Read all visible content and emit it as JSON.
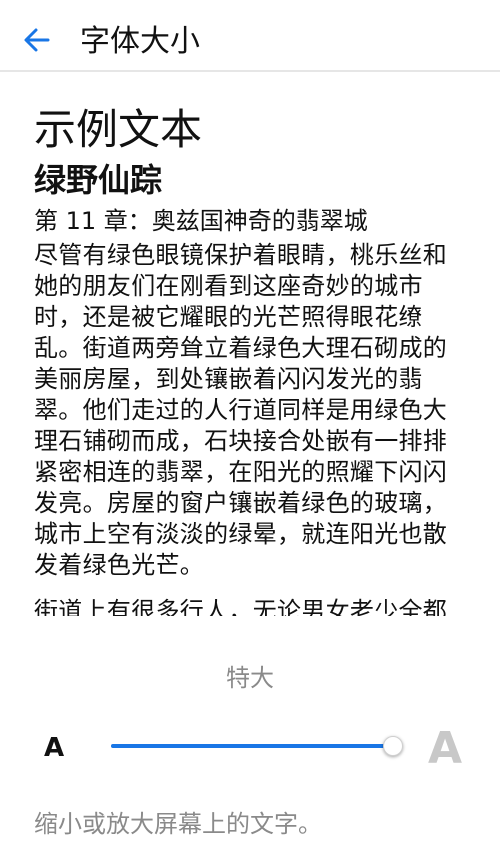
{
  "topbar": {
    "title": "字体大小",
    "back_icon": "arrow-left-icon",
    "accent": "#1976e6"
  },
  "preview": {
    "sample_title": "示例文本",
    "book_title": "绿野仙踪",
    "chapter_title": "第 11 章：奥兹国神奇的翡翠城",
    "paragraph1_lines": [
      "尽管有绿色眼镜保护着眼睛，桃乐丝和",
      "她的朋友们在刚看到这座奇妙的城市",
      "时，还是被它耀眼的光芒照得眼花缭",
      "乱。街道两旁耸立着绿色大理石砌成的",
      "美丽房屋，到处镶嵌着闪闪发光的翡",
      "翠。他们走过的人行道同样是用绿色大",
      "理石铺砌而成，石块接合处嵌有一排排",
      "紧密相连的翡翠，在阳光的照耀下闪闪",
      "发亮。房屋的窗户镶嵌着绿色的玻璃，",
      "城市上空有淡淡的绿晕，就连阳光也散",
      "发着绿色光芒。"
    ],
    "paragraph2": "街道上有很多行人，无论男女老少全都"
  },
  "controls": {
    "size_label": "特大",
    "small_a": "A",
    "large_a": "A",
    "slider_value": 1.0,
    "hint": "缩小或放大屏幕上的文字。"
  }
}
